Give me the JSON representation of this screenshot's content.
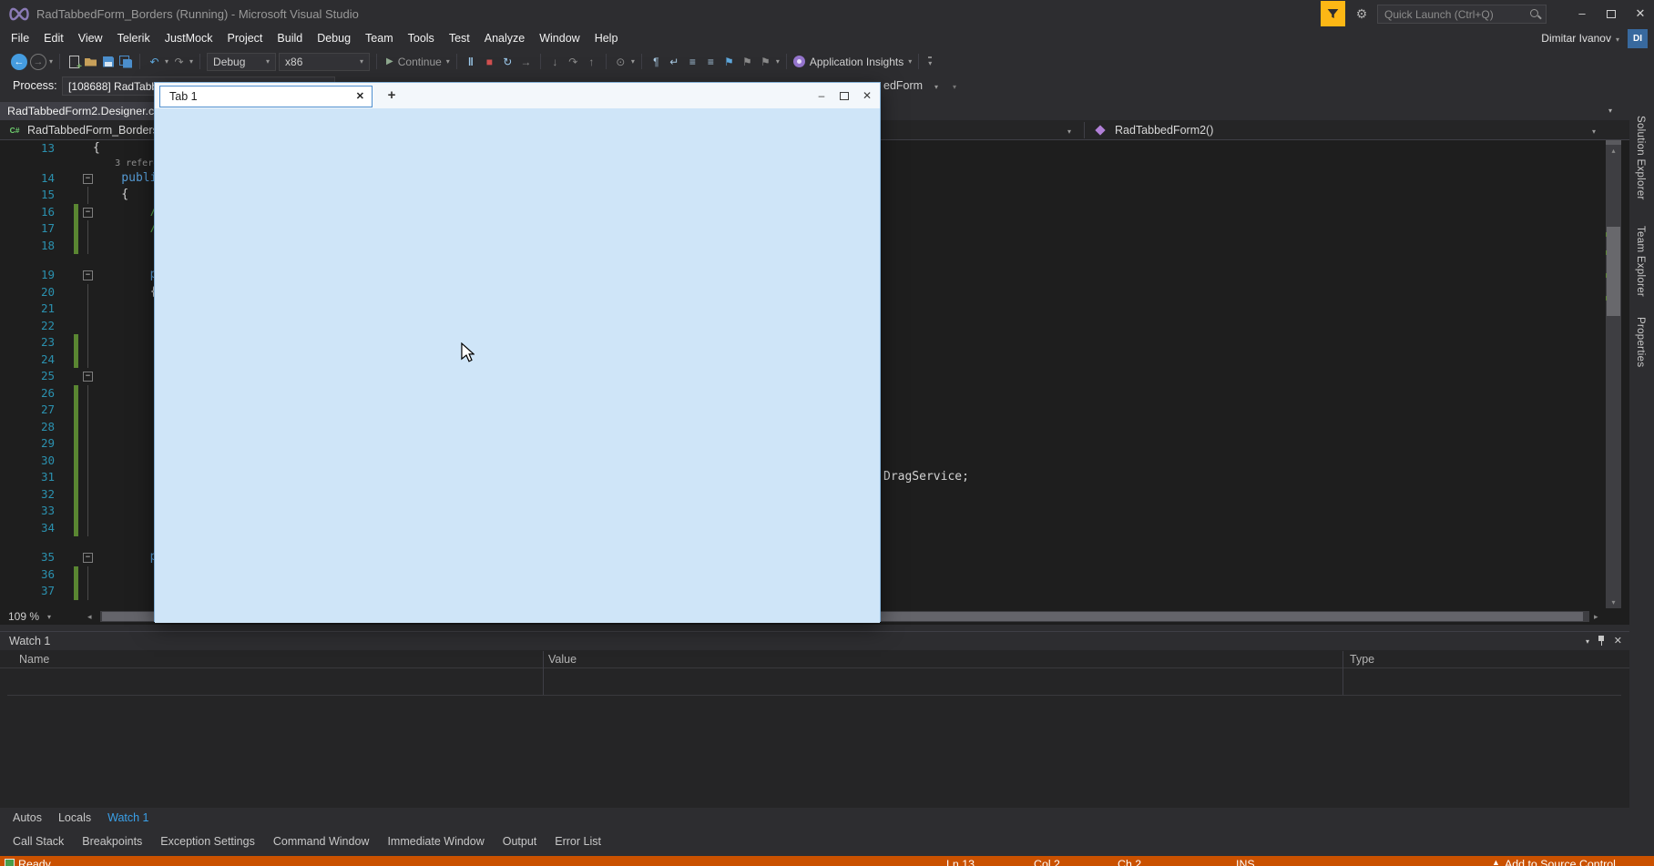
{
  "colors": {
    "chrome_bg": "#2d2d30",
    "editor_bg": "#1e1e1e",
    "panel_bg": "#252526",
    "accent_blue": "#007acc",
    "status_debug_orange": "#ca5100",
    "change_bar_green": "#5a8632",
    "line_number_blue": "#2b91af",
    "keyword_blue": "#569cd6",
    "window_content_blue": "#cfe5f8",
    "funnel_yellow": "#fcb715"
  },
  "icons": {
    "back": "←",
    "forward": "→",
    "caret": "▾",
    "undo": "↶",
    "redo": "↷",
    "play": "▶",
    "pause": "‖",
    "stop": "■",
    "restart": "↻",
    "next_statement": "→",
    "step_into": "↓",
    "step_over": "↷",
    "step_out": "↑",
    "target": "⊙",
    "pilcrow": "¶",
    "wrap": "↵",
    "lines": "≡",
    "bookmark": "⚑",
    "overflow": "▾",
    "minimize": "–",
    "close": "✕",
    "plus": "+",
    "up_arrow": "▲",
    "left_arrow": "◂",
    "right_arrow": "▸",
    "up_small": "▴",
    "down_small": "▾"
  },
  "titlebar": {
    "title": "RadTabbedForm_Borders (Running) - Microsoft Visual Studio",
    "quick_launch_placeholder": "Quick Launch (Ctrl+Q)"
  },
  "account": {
    "name": "Dimitar Ivanov",
    "initials": "DI"
  },
  "menu": {
    "items": [
      {
        "label": "File"
      },
      {
        "label": "Edit"
      },
      {
        "label": "View"
      },
      {
        "label": "Telerik"
      },
      {
        "label": "JustMock"
      },
      {
        "label": "Project"
      },
      {
        "label": "Build"
      },
      {
        "label": "Debug"
      },
      {
        "label": "Team"
      },
      {
        "label": "Tools"
      },
      {
        "label": "Test"
      },
      {
        "label": "Analyze"
      },
      {
        "label": "Window"
      },
      {
        "label": "Help"
      }
    ]
  },
  "toolbar": {
    "debug_target": "Debug",
    "platform": "x86",
    "continue_label": "Continue",
    "app_insights": "Application Insights"
  },
  "process_bar": {
    "label": "Process:",
    "process_text": "[108688] RadTabb",
    "right_fragment": "edForm"
  },
  "doc_tab": {
    "label": "RadTabbedForm2.Designer.cs"
  },
  "nav": {
    "file_icon_text": "C#",
    "scope": "RadTabbedForm_Borders",
    "member": "RadTabbedForm2()"
  },
  "editor": {
    "zoom": "109 %",
    "fragment_right": "DragService;",
    "lines": [
      {
        "no": "13",
        "code": "{",
        "cls": "plain"
      },
      {
        "no": "14",
        "lens": true,
        "lens_text": "    3 refere",
        "fold": true,
        "code": "    publi",
        "cls": "kw"
      },
      {
        "no": "15",
        "guide": true,
        "code": "    {",
        "cls": "plain"
      },
      {
        "no": "16",
        "fold": true,
        "bar": true,
        "code": "        //",
        "cls": "comment"
      },
      {
        "no": "17",
        "guide": true,
        "bar": true,
        "code": "        //",
        "cls": "comment"
      },
      {
        "no": "18",
        "guide": true,
        "bar": true
      },
      {
        "no": "19",
        "lens": true,
        "lens_text": "",
        "fold": true,
        "code": "        p",
        "cls": "kw"
      },
      {
        "no": "20",
        "guide": true,
        "code": "        {",
        "cls": "plain"
      },
      {
        "no": "21",
        "guide": true
      },
      {
        "no": "22",
        "guide": true
      },
      {
        "no": "23",
        "guide": true,
        "bar": true
      },
      {
        "no": "24",
        "guide": true,
        "bar": true
      },
      {
        "no": "25",
        "fold": true
      },
      {
        "no": "26",
        "guide": true,
        "bar": true
      },
      {
        "no": "27",
        "guide": true,
        "bar": true
      },
      {
        "no": "28",
        "guide": true,
        "bar": true
      },
      {
        "no": "29",
        "guide": true,
        "bar": true
      },
      {
        "no": "30",
        "guide": true,
        "bar": true
      },
      {
        "no": "31",
        "guide": true,
        "bar": true
      },
      {
        "no": "32",
        "guide": true,
        "bar": true
      },
      {
        "no": "33",
        "guide": true,
        "bar": true
      },
      {
        "no": "34",
        "guide": true,
        "bar": true
      },
      {
        "no": "35",
        "lens": true,
        "lens_text": "",
        "fold": true,
        "code": "        p",
        "cls": "kw"
      },
      {
        "no": "36",
        "guide": true,
        "bar": true
      },
      {
        "no": "37",
        "guide": true,
        "bar": true
      }
    ]
  },
  "floating_window": {
    "tab_label": "Tab 1"
  },
  "watch": {
    "title": "Watch 1",
    "columns": [
      {
        "label": "Name"
      },
      {
        "label": "Value"
      },
      {
        "label": "Type"
      }
    ]
  },
  "panel_tabs": [
    {
      "label": "Autos"
    },
    {
      "label": "Locals"
    },
    {
      "label": "Watch 1",
      "active": true
    }
  ],
  "window_tabs": [
    {
      "label": "Call Stack"
    },
    {
      "label": "Breakpoints"
    },
    {
      "label": "Exception Settings"
    },
    {
      "label": "Command Window"
    },
    {
      "label": "Immediate Window"
    },
    {
      "label": "Output"
    },
    {
      "label": "Error List"
    }
  ],
  "side_tabs": [
    {
      "label": "Solution Explorer"
    },
    {
      "label": "Team Explorer"
    },
    {
      "label": "Properties"
    }
  ],
  "status_bar": {
    "ready": "Ready",
    "ln": "Ln 13",
    "col": "Col 2",
    "ch": "Ch 2",
    "mode": "INS",
    "source_control": "Add to Source Control"
  }
}
